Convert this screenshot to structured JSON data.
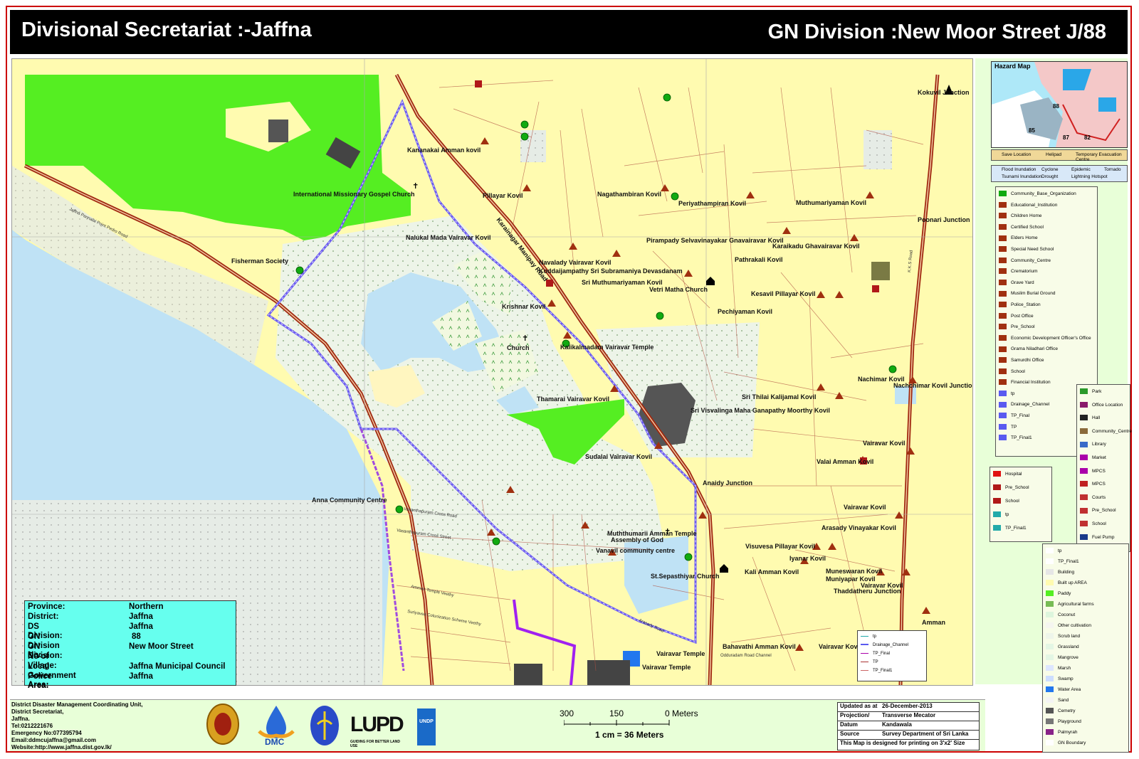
{
  "header": {
    "left_title": "Divisional Secretariat :-Jaffna",
    "right_title": "GN Division :New Moor Street J/88"
  },
  "map": {
    "place_labels": [
      "Kananakai Amman kovil",
      "International  Missionary Gospel Church",
      "Pillayar Kovil",
      "Nagathambiran Kovil",
      "Periyathampiran Kovil",
      "Muthumariyaman Kovil",
      "Nalukal Mada Vairavar Kovil",
      "Fisherman Society",
      "Navalady Vairavar Kovil",
      "Koddaijampathy Sri Subramaniya Devasdanam",
      "Sri Muthumariyaman Kovil",
      "Vetri Matha Church",
      "Pirampady Selvavinayakar Gnavairavar Kovil",
      "Karaikadu Ghavairavar Kovil",
      "Pathrakali Kovil",
      "Kesavil Pillayar Kovil",
      "Krishnar Kovil",
      "Pechiyaman Kovil",
      "Church",
      "Kalikalmadam Vairavar Temple",
      "Thamarai Vairavar Kovil",
      "Sri Thilai Kalijamal Kovil",
      "Sri Visvalinga Maha Ganapathy Moorthy Kovil",
      "Nachimar Kovil",
      "Nachchimar Kovil Junction",
      "Sudalai Vairavar Kovil",
      "Vairavar Kovil",
      "Valai Amman Kovil",
      "Anaidy Junction",
      "Anna Community Centre",
      "Vairavar Kovil",
      "Muththumarii Amman Temple",
      "Assembly of God",
      "Vanavil community centre",
      "Arasady Vinayakar Kovil",
      "Visuvesa Pillayar Kovil",
      "Iyanar Kovil",
      "St.Sepasthiyar Church",
      "Kali Amman Kovil",
      "Muneswaran Kovil",
      "Muniyapar Kovil",
      "Vairavar Kovil",
      "Thaddatheru Junction",
      "Vairavar Temple",
      "Bahavathi Amman Kovil",
      "Vairavar Temple",
      "Kokuvil Junction",
      "Poonari Junction",
      "Vairavar Kovil",
      "Amman"
    ],
    "road_labels": [
      "Karainagar Manipay Road",
      "Jaffna Pannalai Point Pedro Road",
      "K.K.S Road",
      "Vasanthapuram Cross Road",
      "Vasanthapuram Cross Street",
      "Amman Temple Veethy",
      "Suriyavea Colonization Scheme Veethy",
      "Odduradam Road Channel",
      "Arasady Road"
    ]
  },
  "info_box": {
    "rows": [
      {
        "key": "Province:",
        "value": "Northern"
      },
      {
        "key": "District:",
        "value": "Jaffna"
      },
      {
        "key": "DS Division:",
        "value": "Jaffna"
      },
      {
        "key": "GN Division No:",
        "value": "88"
      },
      {
        "key": "GN Division:",
        "value": "New Moor Street"
      },
      {
        "key": "No of Village:",
        "value": ""
      },
      {
        "key": "Local Government Area:",
        "value": "Jaffna Municipal Council"
      },
      {
        "key": "Police Area:",
        "value": "Jaffna"
      }
    ]
  },
  "mini_legend": [
    "tp",
    "Drainage_Channel",
    "TP_Final",
    "TP",
    "TP_Final1"
  ],
  "hazard_map": {
    "title": "Hazard Map",
    "numbers": [
      "88",
      "85",
      "87",
      "82"
    ],
    "legend1": [
      "Save Location",
      "Helipad",
      "Temporary Evacuation Centre"
    ],
    "legend2": [
      "Flood Inundation",
      "Cyclone",
      "Epidemic",
      "Tornado",
      "Tsunami Inundation",
      "Drought",
      "Lightning Hotspot"
    ]
  },
  "legend_main": [
    "Community_Base_Organization",
    "Educational_Institution",
    "Children Home",
    "Certified School",
    "Elders Home",
    "Special  Need School",
    "Community_Centre",
    "Crematorium",
    "Grave Yard",
    "Muslim Burial Ground",
    "Police_Station",
    "Post Office",
    "Pre_School",
    "Economic Development Officer's Office",
    "Grama Niladhari Office",
    "Samurdhi Office",
    "School",
    "Financial Institution",
    "tp",
    "Drainage_Channel",
    "TP_Final",
    "TP",
    "TP_Final1"
  ],
  "legend_small": [
    "Hospital",
    "Pre_School",
    "School",
    "tp",
    "TP_Final1"
  ],
  "legend_side": [
    "Park",
    "Office Location",
    "Hall",
    "Community_Centre",
    "Library",
    "Market",
    "MPCS",
    "MPCS",
    "Courts",
    "Pre_School",
    "School",
    "Fuel Pump"
  ],
  "legend_landuse": [
    {
      "name": "tp",
      "color": "#ffffff"
    },
    {
      "name": "TP_Final1",
      "color": "#ffffff"
    },
    {
      "name": "Building",
      "color": "#e6e6e6"
    },
    {
      "name": "Built up AREA",
      "color": "#fffbb0"
    },
    {
      "name": "Paddy",
      "color": "#55ee22"
    },
    {
      "name": "Agricultural farms",
      "color": "#77bb55"
    },
    {
      "name": "Coconut",
      "color": "#ddf5dd"
    },
    {
      "name": "Other cultivation",
      "color": "#f5f5f0"
    },
    {
      "name": "Scrub land",
      "color": "#eef5ea"
    },
    {
      "name": "Grassland",
      "color": "#e4f6e4"
    },
    {
      "name": "Mangrove",
      "color": "#e4f6e4"
    },
    {
      "name": "Marsh",
      "color": "#dde6ff"
    },
    {
      "name": "Swamp",
      "color": "#ccddff"
    },
    {
      "name": "Water Area",
      "color": "#2277ee"
    },
    {
      "name": "Sand",
      "color": "#f4f4f4"
    },
    {
      "name": "Cemetry",
      "color": "#555555"
    },
    {
      "name": "Playground",
      "color": "#777777"
    },
    {
      "name": "Palmyrah",
      "color": "#882288"
    },
    {
      "name": "GN Boundary",
      "color": "#ffffff"
    }
  ],
  "footer": {
    "address_lines": [
      "District Disaster Management Coordinating Unit,",
      "District Secretariat,",
      "Jaffna.",
      "Tel:0212221676",
      "Emergency No:077395794",
      "Email:ddmcujaffna@gmail.com",
      "Website:http://www.jaffna.dist.gov.lk/"
    ],
    "logos": [
      "DMC",
      "LUPD",
      "GUIDING FOR BETTER LAND USE",
      "UNDP"
    ],
    "scale": {
      "labels": [
        "300",
        "150",
        "0 Meters"
      ],
      "ratio": "1 cm = 36 Meters"
    },
    "update": [
      {
        "key": "Updated as at",
        "value": "26-December-2013"
      },
      {
        "key": "Projection/",
        "value": "Transverse Mecator"
      },
      {
        "key": "Datum",
        "value": "Kandawala"
      },
      {
        "key": "Source",
        "value": "Survey Department of Sri Lanka"
      }
    ],
    "print_note": "This Map is designed for printing on 3'x2' Size"
  },
  "colors": {
    "built_up": "#fffbb0",
    "paddy": "#55ee22",
    "water": "#bfe2f5",
    "road": "#a02810",
    "boundary": "#8a3ad8",
    "info_bg": "#66ffee"
  }
}
